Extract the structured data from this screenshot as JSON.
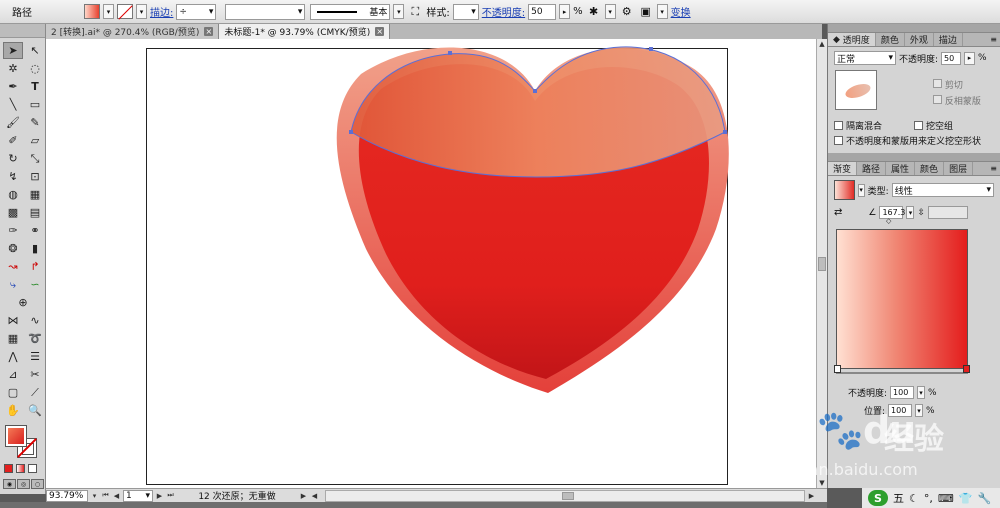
{
  "control_bar": {
    "object_type": "路径",
    "stroke_label": "描边:",
    "stroke_weight": "",
    "stroke_profile": "",
    "brush": "基本",
    "style_label": "样式:",
    "opacity_label": "不透明度:",
    "opacity_value": "50",
    "opacity_unit": "%",
    "transform_label": "变换"
  },
  "doc_tabs": [
    {
      "label": "2 [转换].ai* @ 270.4% (RGB/预览)"
    },
    {
      "label": "未标题-1* @ 93.79% (CMYK/预览)"
    }
  ],
  "status_bar": {
    "zoom": "93.79%",
    "page": "1",
    "history_text": "12 次还原；无重做"
  },
  "transparency_panel": {
    "tabs": [
      "透明度",
      "颜色",
      "外观",
      "描边"
    ],
    "blend_mode": "正常",
    "opacity_label": "不透明度:",
    "opacity_value": "50",
    "opacity_unit": "%",
    "clip_label": "剪切",
    "invert_mask_label": "反相蒙版",
    "isolate_label": "隔离混合",
    "knockout_label": "挖空组",
    "define_knockout_label": "不透明度和蒙版用来定义挖空形状"
  },
  "gradient_panel": {
    "tabs": [
      "渐变",
      "路径",
      "属性",
      "颜色",
      "图层"
    ],
    "type_label": "类型:",
    "type_value": "线性",
    "angle_value": "167.3",
    "opacity_label": "不透明度:",
    "opacity_value": "100",
    "location_label": "位置:",
    "location_value": "100",
    "percent": "%"
  },
  "watermark": {
    "logo": "Bai",
    "logo_tail": "du",
    "cn": "经验",
    "url": "jingyan.baidu.com"
  },
  "tray": {
    "ime": "S",
    "ime_mode": "五"
  },
  "colors": {
    "heart_red": "#e3201f",
    "heart_highlight": "#ef8f6c",
    "panel_gray": "#d4d4d4"
  },
  "icons": {
    "selection": "arrow",
    "direct_selection": "hollow-arrow",
    "pen": "pen",
    "type": "T",
    "rectangle": "rectangle",
    "gradient": "gradient",
    "hand": "hand",
    "zoom": "magnifier"
  }
}
